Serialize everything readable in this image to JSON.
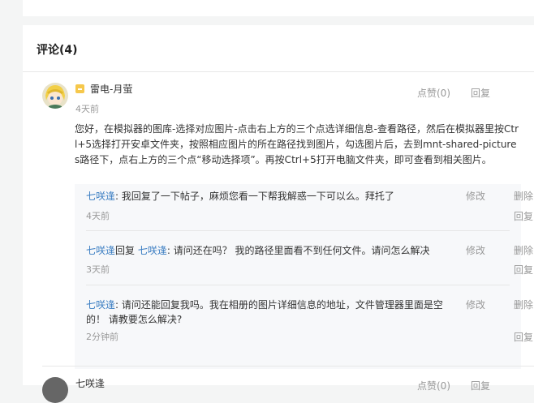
{
  "section": {
    "title": "评论(4)"
  },
  "comments": [
    {
      "username": "雷电-月萤",
      "time": "4天前",
      "like": "点赞(0)",
      "reply": "回复",
      "text": "您好，在模拟器的图库-选择对应图片-点击右上方的三个点选详细信息-查看路径，然后在模拟器里按Ctrl+5选择打开安卓文件夹，按照相应图片的所在路径找到图片，勾选图片后，去到mnt-shared-pictures路径下，点右上方的三个点“移动选择项”。再按Ctrl+5打开电脑文件夹，即可查看到相关图片。",
      "replies": [
        {
          "user": "七咲逢",
          "reply_to_label": "",
          "reply_to": "",
          "text": ": 我回复了一下帖子，麻烦您看一下帮我解惑一下可以么。拜托了",
          "edit": "修改",
          "delete": "删除",
          "time": "4天前",
          "reply": "回复"
        },
        {
          "user": "七咲逢",
          "reply_to_label": "回复 ",
          "reply_to": "七咲逢",
          "text": ": 请问还在吗？ 我的路径里面看不到任何文件。请问怎么解决",
          "edit": "修改",
          "delete": "删除",
          "time": "3天前",
          "reply": "回复"
        },
        {
          "user": "七咲逢",
          "reply_to_label": "",
          "reply_to": "",
          "text": ": 请问还能回复我吗。我在相册的图片详细信息的地址，文件管理器里面是空的！ 请教要怎么解决?",
          "edit": "修改",
          "delete": "删除",
          "time": "2分钟前",
          "reply": "回复"
        }
      ]
    },
    {
      "username": "七咲逢",
      "like": "点赞(0)",
      "reply": "回复"
    }
  ],
  "colors": {
    "link": "#3a7dc2",
    "muted": "#999999",
    "badge": "#f6c84c"
  }
}
